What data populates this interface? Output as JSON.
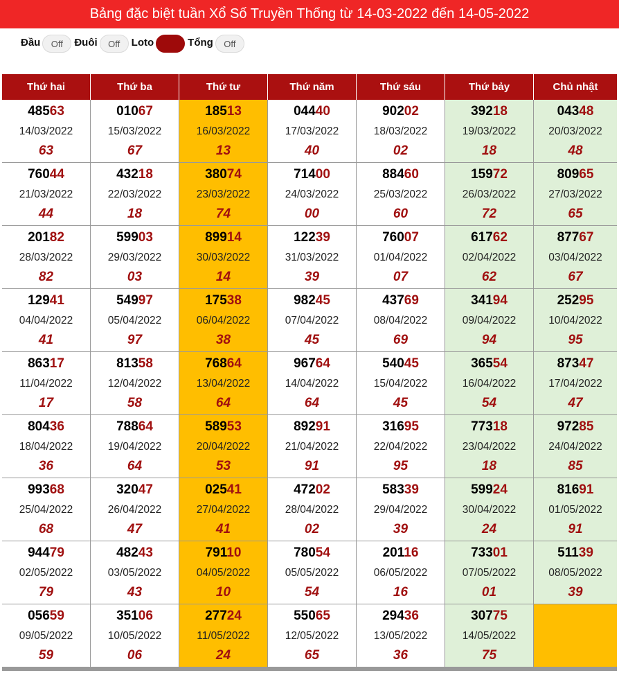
{
  "title": "Bảng đặc biệt tuần Xổ Số Truyền Thống từ 14-03-2022 đến 14-05-2022",
  "toggles": [
    {
      "label": "Đầu",
      "state": "Off",
      "on": false
    },
    {
      "label": "Đuôi",
      "state": "Off",
      "on": false
    },
    {
      "label": "Loto",
      "state": "",
      "on": true
    },
    {
      "label": "Tổng",
      "state": "Off",
      "on": false
    }
  ],
  "headers": [
    "Thứ hai",
    "Thứ ba",
    "Thứ tư",
    "Thứ năm",
    "Thứ sáu",
    "Thứ bảy",
    "Chủ nhật"
  ],
  "colors": {
    "title_bg": "#ef2626",
    "header_bg": "#aa1010",
    "accent": "#a01010",
    "highlight": "#ffbe00",
    "weekend": "#dff0d8"
  },
  "rows": [
    [
      {
        "number": "48563",
        "date": "14/03/2022",
        "loto": "63"
      },
      {
        "number": "01067",
        "date": "15/03/2022",
        "loto": "67"
      },
      {
        "number": "18513",
        "date": "16/03/2022",
        "loto": "13"
      },
      {
        "number": "04440",
        "date": "17/03/2022",
        "loto": "40"
      },
      {
        "number": "90202",
        "date": "18/03/2022",
        "loto": "02"
      },
      {
        "number": "39218",
        "date": "19/03/2022",
        "loto": "18"
      },
      {
        "number": "04348",
        "date": "20/03/2022",
        "loto": "48"
      }
    ],
    [
      {
        "number": "76044",
        "date": "21/03/2022",
        "loto": "44"
      },
      {
        "number": "43218",
        "date": "22/03/2022",
        "loto": "18"
      },
      {
        "number": "38074",
        "date": "23/03/2022",
        "loto": "74"
      },
      {
        "number": "71400",
        "date": "24/03/2022",
        "loto": "00"
      },
      {
        "number": "88460",
        "date": "25/03/2022",
        "loto": "60"
      },
      {
        "number": "15972",
        "date": "26/03/2022",
        "loto": "72"
      },
      {
        "number": "80965",
        "date": "27/03/2022",
        "loto": "65"
      }
    ],
    [
      {
        "number": "20182",
        "date": "28/03/2022",
        "loto": "82"
      },
      {
        "number": "59903",
        "date": "29/03/2022",
        "loto": "03"
      },
      {
        "number": "89914",
        "date": "30/03/2022",
        "loto": "14"
      },
      {
        "number": "12239",
        "date": "31/03/2022",
        "loto": "39"
      },
      {
        "number": "76007",
        "date": "01/04/2022",
        "loto": "07"
      },
      {
        "number": "61762",
        "date": "02/04/2022",
        "loto": "62"
      },
      {
        "number": "87767",
        "date": "03/04/2022",
        "loto": "67"
      }
    ],
    [
      {
        "number": "12941",
        "date": "04/04/2022",
        "loto": "41"
      },
      {
        "number": "54997",
        "date": "05/04/2022",
        "loto": "97"
      },
      {
        "number": "17538",
        "date": "06/04/2022",
        "loto": "38"
      },
      {
        "number": "98245",
        "date": "07/04/2022",
        "loto": "45"
      },
      {
        "number": "43769",
        "date": "08/04/2022",
        "loto": "69"
      },
      {
        "number": "34194",
        "date": "09/04/2022",
        "loto": "94"
      },
      {
        "number": "25295",
        "date": "10/04/2022",
        "loto": "95"
      }
    ],
    [
      {
        "number": "86317",
        "date": "11/04/2022",
        "loto": "17"
      },
      {
        "number": "81358",
        "date": "12/04/2022",
        "loto": "58"
      },
      {
        "number": "76864",
        "date": "13/04/2022",
        "loto": "64"
      },
      {
        "number": "96764",
        "date": "14/04/2022",
        "loto": "64"
      },
      {
        "number": "54045",
        "date": "15/04/2022",
        "loto": "45"
      },
      {
        "number": "36554",
        "date": "16/04/2022",
        "loto": "54"
      },
      {
        "number": "87347",
        "date": "17/04/2022",
        "loto": "47"
      }
    ],
    [
      {
        "number": "80436",
        "date": "18/04/2022",
        "loto": "36"
      },
      {
        "number": "78864",
        "date": "19/04/2022",
        "loto": "64"
      },
      {
        "number": "58953",
        "date": "20/04/2022",
        "loto": "53"
      },
      {
        "number": "89291",
        "date": "21/04/2022",
        "loto": "91"
      },
      {
        "number": "31695",
        "date": "22/04/2022",
        "loto": "95"
      },
      {
        "number": "77318",
        "date": "23/04/2022",
        "loto": "18"
      },
      {
        "number": "97285",
        "date": "24/04/2022",
        "loto": "85"
      }
    ],
    [
      {
        "number": "99368",
        "date": "25/04/2022",
        "loto": "68"
      },
      {
        "number": "32047",
        "date": "26/04/2022",
        "loto": "47"
      },
      {
        "number": "02541",
        "date": "27/04/2022",
        "loto": "41"
      },
      {
        "number": "47202",
        "date": "28/04/2022",
        "loto": "02"
      },
      {
        "number": "58339",
        "date": "29/04/2022",
        "loto": "39"
      },
      {
        "number": "59924",
        "date": "30/04/2022",
        "loto": "24"
      },
      {
        "number": "81691",
        "date": "01/05/2022",
        "loto": "91"
      }
    ],
    [
      {
        "number": "94479",
        "date": "02/05/2022",
        "loto": "79"
      },
      {
        "number": "48243",
        "date": "03/05/2022",
        "loto": "43"
      },
      {
        "number": "79110",
        "date": "04/05/2022",
        "loto": "10"
      },
      {
        "number": "78054",
        "date": "05/05/2022",
        "loto": "54"
      },
      {
        "number": "20116",
        "date": "06/05/2022",
        "loto": "16"
      },
      {
        "number": "73301",
        "date": "07/05/2022",
        "loto": "01"
      },
      {
        "number": "51139",
        "date": "08/05/2022",
        "loto": "39"
      }
    ],
    [
      {
        "number": "05659",
        "date": "09/05/2022",
        "loto": "59"
      },
      {
        "number": "35106",
        "date": "10/05/2022",
        "loto": "06"
      },
      {
        "number": "27724",
        "date": "11/05/2022",
        "loto": "24"
      },
      {
        "number": "55065",
        "date": "12/05/2022",
        "loto": "65"
      },
      {
        "number": "29436",
        "date": "13/05/2022",
        "loto": "36"
      },
      {
        "number": "30775",
        "date": "14/05/2022",
        "loto": "75"
      },
      null
    ]
  ]
}
